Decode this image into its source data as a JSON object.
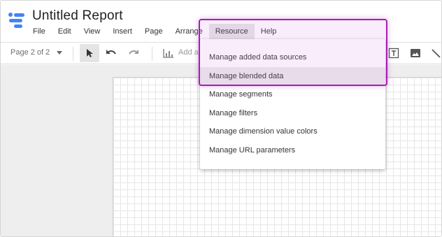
{
  "app": {
    "title": "Untitled Report",
    "logo_icon": "data-studio-logo-icon"
  },
  "menubar": {
    "items": [
      "File",
      "Edit",
      "View",
      "Insert",
      "Page",
      "Arrange",
      "Resource",
      "Help"
    ],
    "active": "Resource"
  },
  "toolbar": {
    "page_selector": "Page 2 of 2",
    "add_label": "Add a",
    "tools": [
      {
        "name": "select-tool",
        "icon": "cursor-arrow-icon",
        "selected": true
      },
      {
        "name": "undo",
        "icon": "undo-icon",
        "selected": false
      },
      {
        "name": "redo",
        "icon": "redo-icon",
        "selected": false
      },
      {
        "name": "add-chart",
        "icon": "bar-chart-icon",
        "selected": false
      },
      {
        "name": "text-tool",
        "icon": "text-box-icon",
        "selected": false
      },
      {
        "name": "image-tool",
        "icon": "image-icon",
        "selected": false
      },
      {
        "name": "line-tool",
        "icon": "line-icon",
        "selected": false
      }
    ]
  },
  "resource_menu": {
    "items": [
      "Manage added data sources",
      "Manage blended data",
      "Manage segments",
      "Manage filters",
      "Manage dimension value colors",
      "Manage URL parameters"
    ],
    "hovered": "Manage blended data"
  },
  "colors": {
    "highlight_border": "#a61fb3",
    "logo_blue": "#4285f4",
    "menu_hover": "#ececec"
  }
}
